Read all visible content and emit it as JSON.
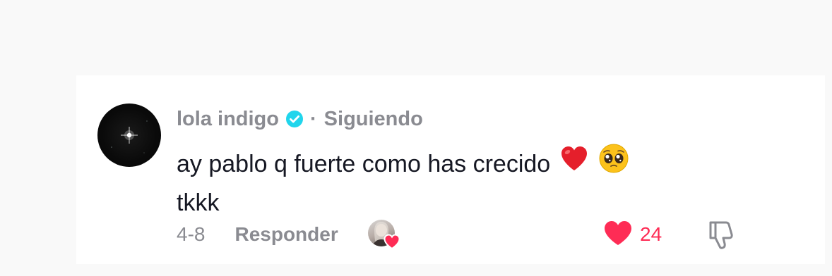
{
  "comment": {
    "author": {
      "name": "lola indigo",
      "verified_icon": "verified-badge-icon",
      "separator": "·",
      "follow_status": "Siguiendo"
    },
    "text_lines": [
      "ay pablo q fuerte como has crecido",
      "tkkk"
    ],
    "emojis": [
      "❤️",
      "🥹"
    ],
    "date": "4-8",
    "reply_label": "Responder",
    "likes": {
      "count": "24",
      "icon": "heart-icon"
    },
    "dislike_icon": "thumbs-down-icon",
    "creator_liked_icon": "creator-liked-heart-icon"
  },
  "colors": {
    "muted_text": "#8a8b91",
    "body_text": "#161823",
    "like_red": "#fe2c55",
    "verified_blue": "#20d5ec",
    "page_bg": "#f9f9f9",
    "card_bg": "#ffffff"
  }
}
